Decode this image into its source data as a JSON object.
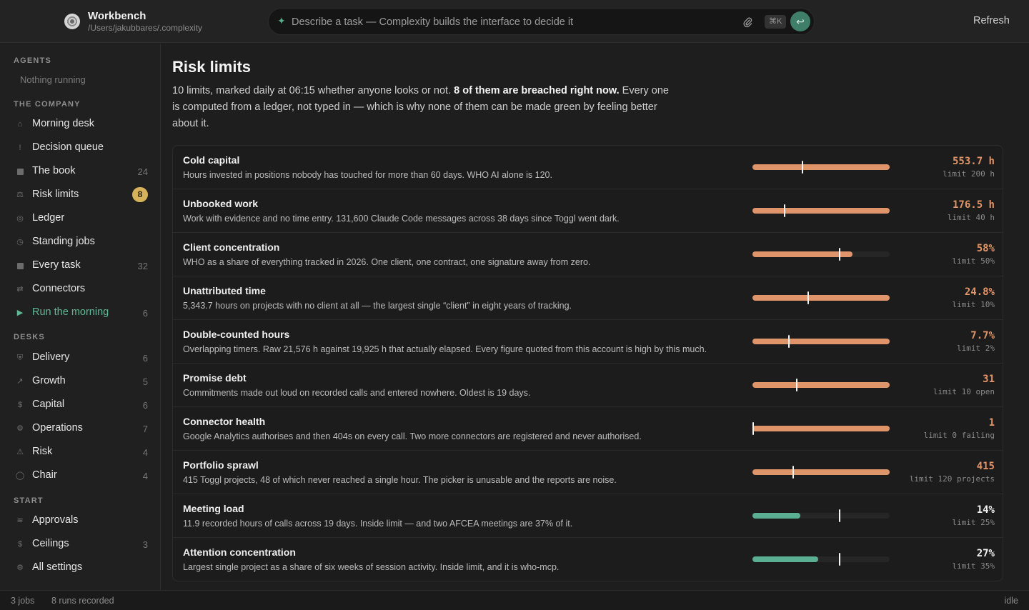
{
  "app": {
    "title": "Workbench",
    "path": "/Users/jakubbares/.complexity",
    "refresh_label": "Refresh"
  },
  "command": {
    "placeholder": "Describe a task — Complexity builds the interface to decide it",
    "shortcut": "⌘K"
  },
  "sidebar": {
    "agents_title": "AGENTS",
    "agents_empty": "Nothing running",
    "company_title": "THE COMPANY",
    "company": [
      {
        "icon": "home-icon",
        "label": "Morning desk",
        "count": ""
      },
      {
        "icon": "exclamation-icon",
        "label": "Decision queue",
        "count": ""
      },
      {
        "icon": "book-icon",
        "label": "The book",
        "count": "24"
      },
      {
        "icon": "scale-icon",
        "label": "Risk limits",
        "badge": "8"
      },
      {
        "icon": "ledger-icon",
        "label": "Ledger",
        "count": ""
      },
      {
        "icon": "clock-icon",
        "label": "Standing jobs",
        "count": ""
      },
      {
        "icon": "task-icon",
        "label": "Every task",
        "count": "32"
      },
      {
        "icon": "connector-icon",
        "label": "Connectors",
        "count": ""
      },
      {
        "icon": "play-icon",
        "label": "Run the morning",
        "count": "6"
      }
    ],
    "desks_title": "DESKS",
    "desks": [
      {
        "icon": "shield-icon",
        "label": "Delivery",
        "count": "6"
      },
      {
        "icon": "arrow-up-right-icon",
        "label": "Growth",
        "count": "5"
      },
      {
        "icon": "dollar-icon",
        "label": "Capital",
        "count": "6"
      },
      {
        "icon": "gear-icon",
        "label": "Operations",
        "count": "7"
      },
      {
        "icon": "warning-icon",
        "label": "Risk",
        "count": "4"
      },
      {
        "icon": "chair-icon",
        "label": "Chair",
        "count": "4"
      }
    ],
    "start_title": "START",
    "start": [
      {
        "icon": "check-icon",
        "label": "Approvals",
        "count": ""
      },
      {
        "icon": "dollar-icon",
        "label": "Ceilings",
        "count": "3"
      },
      {
        "icon": "gear-icon",
        "label": "All settings",
        "count": ""
      }
    ]
  },
  "page": {
    "title": "Risk limits",
    "intro_1": "10 limits, marked daily at 06:15 whether anyone looks or not. ",
    "intro_bold": "8 of them are breached right now.",
    "intro_2": " Every one is computed from a ledger, not typed in — which is why none of them can be made green by feeling better about it."
  },
  "limits": [
    {
      "name": "Cold capital",
      "desc": "Hours invested in positions nobody has touched for more than 60 days. WHO AI alone is 120.",
      "value": "553.7 h",
      "limit": "limit 200 h",
      "fill": 1.0,
      "mark": 0.36,
      "breached": true
    },
    {
      "name": "Unbooked work",
      "desc": "Work with evidence and no time entry. 131,600 Claude Code messages across 38 days since Toggl went dark.",
      "value": "176.5 h",
      "limit": "limit 40 h",
      "fill": 1.0,
      "mark": 0.23,
      "breached": true
    },
    {
      "name": "Client concentration",
      "desc": "WHO as a share of everything tracked in 2026. One client, one contract, one signature away from zero.",
      "value": "58%",
      "limit": "limit 50%",
      "fill": 0.73,
      "mark": 0.63,
      "breached": true
    },
    {
      "name": "Unattributed time",
      "desc": "5,343.7 hours on projects with no client at all — the largest single “client” in eight years of tracking.",
      "value": "24.8%",
      "limit": "limit 10%",
      "fill": 1.0,
      "mark": 0.4,
      "breached": true
    },
    {
      "name": "Double-counted hours",
      "desc": "Overlapping timers. Raw 21,576 h against 19,925 h that actually elapsed. Every figure quoted from this account is high by this much.",
      "value": "7.7%",
      "limit": "limit 2%",
      "fill": 1.0,
      "mark": 0.26,
      "breached": true
    },
    {
      "name": "Promise debt",
      "desc": "Commitments made out loud on recorded calls and entered nowhere. Oldest is 19 days.",
      "value": "31",
      "limit": "limit 10 open",
      "fill": 1.0,
      "mark": 0.32,
      "breached": true
    },
    {
      "name": "Connector health",
      "desc": "Google Analytics authorises and then 404s on every call. Two more connectors are registered and never authorised.",
      "value": "1",
      "limit": "limit 0 failing",
      "fill": 1.0,
      "mark": 0.0,
      "breached": true
    },
    {
      "name": "Portfolio sprawl",
      "desc": "415 Toggl projects, 48 of which never reached a single hour. The picker is unusable and the reports are noise.",
      "value": "415",
      "limit": "limit 120 projects",
      "fill": 1.0,
      "mark": 0.29,
      "breached": true
    },
    {
      "name": "Meeting load",
      "desc": "11.9 recorded hours of calls across 19 days. Inside limit — and two AFCEA meetings are 37% of it.",
      "value": "14%",
      "limit": "limit 25%",
      "fill": 0.35,
      "mark": 0.63,
      "breached": false
    },
    {
      "name": "Attention concentration",
      "desc": "Largest single project as a share of six weeks of session activity. Inside limit, and it is who-mcp.",
      "value": "27%",
      "limit": "limit 35%",
      "fill": 0.48,
      "mark": 0.63,
      "breached": false
    }
  ],
  "status": {
    "jobs": "3 jobs",
    "runs": "8 runs recorded",
    "state": "idle"
  }
}
